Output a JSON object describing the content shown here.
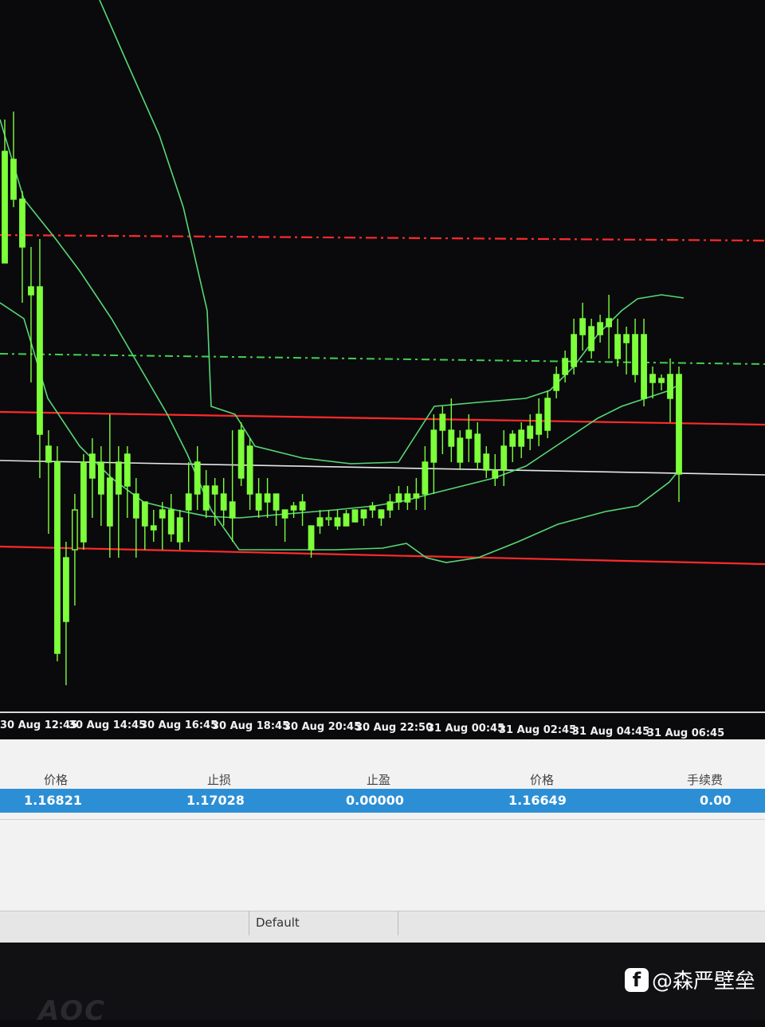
{
  "chart": {
    "time_labels": [
      "30 Aug 12:45",
      "30 Aug 14:45",
      "30 Aug 16:45",
      "30 Aug 18:45",
      "30 Aug 20:45",
      "30 Aug 22:50",
      "31 Aug 00:45",
      "31 Aug 02:45",
      "31 Aug 04:45",
      "31 Aug 06:45"
    ],
    "colors": {
      "background": "#0a0a0d",
      "candle": "#7dff3a",
      "bollinger": "#57d873",
      "level_red": "#ff2a2a",
      "level_green_dash": "#3fd04f",
      "level_white": "#e6e6e6"
    },
    "levels": [
      {
        "style": "red dash-dot"
      },
      {
        "style": "green dash-dot"
      },
      {
        "style": "red solid"
      },
      {
        "style": "white solid"
      },
      {
        "style": "red solid"
      }
    ],
    "candles": [
      [
        330,
        190,
        250,
        150
      ],
      [
        250,
        200,
        260,
        140
      ],
      [
        310,
        250,
        380,
        240
      ],
      [
        370,
        360,
        480,
        310
      ],
      [
        545,
        360,
        600,
        300
      ],
      [
        580,
        560,
        670,
        540
      ],
      [
        820,
        580,
        830,
        560
      ],
      [
        780,
        700,
        860,
        680
      ],
      [
        640,
        690,
        760,
        620
      ],
      [
        680,
        580,
        690,
        570
      ],
      [
        600,
        570,
        650,
        550
      ],
      [
        620,
        580,
        660,
        560
      ],
      [
        660,
        600,
        700,
        520
      ],
      [
        620,
        580,
        700,
        560
      ],
      [
        610,
        570,
        650,
        560
      ],
      [
        650,
        620,
        700,
        600
      ],
      [
        660,
        630,
        690,
        640
      ],
      [
        665,
        660,
        680,
        640
      ],
      [
        650,
        640,
        690,
        630
      ],
      [
        670,
        640,
        680,
        620
      ],
      [
        680,
        650,
        690,
        640
      ],
      [
        640,
        620,
        680,
        580
      ],
      [
        620,
        580,
        640,
        560
      ],
      [
        640,
        610,
        650,
        590
      ],
      [
        620,
        610,
        660,
        600
      ],
      [
        640,
        620,
        660,
        600
      ],
      [
        650,
        630,
        680,
        540
      ],
      [
        600,
        540,
        610,
        530
      ],
      [
        620,
        560,
        640,
        550
      ],
      [
        640,
        620,
        650,
        600
      ],
      [
        630,
        620,
        650,
        600
      ],
      [
        640,
        620,
        660,
        620
      ],
      [
        650,
        640,
        680,
        640
      ],
      [
        640,
        635,
        650,
        630
      ],
      [
        640,
        630,
        660,
        620
      ],
      [
        690,
        660,
        700,
        660
      ],
      [
        660,
        650,
        670,
        640
      ],
      [
        650,
        650,
        660,
        640
      ],
      [
        660,
        650,
        665,
        640
      ],
      [
        660,
        645,
        660,
        640
      ],
      [
        655,
        640,
        655,
        640
      ],
      [
        650,
        640,
        660,
        640
      ],
      [
        640,
        635,
        650,
        630
      ],
      [
        650,
        640,
        660,
        640
      ],
      [
        640,
        630,
        650,
        620
      ],
      [
        630,
        620,
        640,
        610
      ],
      [
        630,
        620,
        640,
        610
      ],
      [
        625,
        620,
        640,
        600
      ],
      [
        620,
        580,
        640,
        560
      ],
      [
        580,
        540,
        620,
        520
      ],
      [
        540,
        520,
        570,
        510
      ],
      [
        560,
        540,
        580,
        500
      ],
      [
        580,
        550,
        590,
        540
      ],
      [
        550,
        540,
        580,
        520
      ],
      [
        580,
        545,
        590,
        530
      ],
      [
        590,
        570,
        600,
        560
      ],
      [
        600,
        590,
        610,
        570
      ],
      [
        590,
        560,
        610,
        540
      ],
      [
        560,
        545,
        580,
        540
      ],
      [
        560,
        540,
        575,
        530
      ],
      [
        550,
        535,
        565,
        520
      ],
      [
        545,
        520,
        560,
        500
      ],
      [
        540,
        500,
        550,
        490
      ],
      [
        490,
        470,
        500,
        460
      ],
      [
        470,
        450,
        480,
        440
      ],
      [
        460,
        420,
        470,
        400
      ],
      [
        420,
        400,
        440,
        380
      ],
      [
        440,
        410,
        450,
        400
      ],
      [
        420,
        405,
        430,
        395
      ],
      [
        410,
        400,
        450,
        370
      ],
      [
        450,
        420,
        460,
        400
      ],
      [
        430,
        420,
        470,
        410
      ],
      [
        470,
        420,
        480,
        400
      ],
      [
        500,
        420,
        510,
        400
      ],
      [
        480,
        470,
        500,
        460
      ],
      [
        480,
        475,
        490,
        470
      ],
      [
        500,
        470,
        530,
        450
      ],
      [
        595,
        470,
        630,
        460
      ]
    ]
  },
  "trade_panel": {
    "headers": [
      "价格",
      "止损",
      "止盈",
      "价格",
      "手续费"
    ],
    "row": [
      "1.16821",
      "1.17028",
      "0.00000",
      "1.16649",
      "0.00"
    ]
  },
  "tabs": {
    "default_label": "Default"
  },
  "bezel": {
    "logo": "AOC"
  },
  "watermark": {
    "text": "@森严壁垒",
    "icon": "f"
  }
}
